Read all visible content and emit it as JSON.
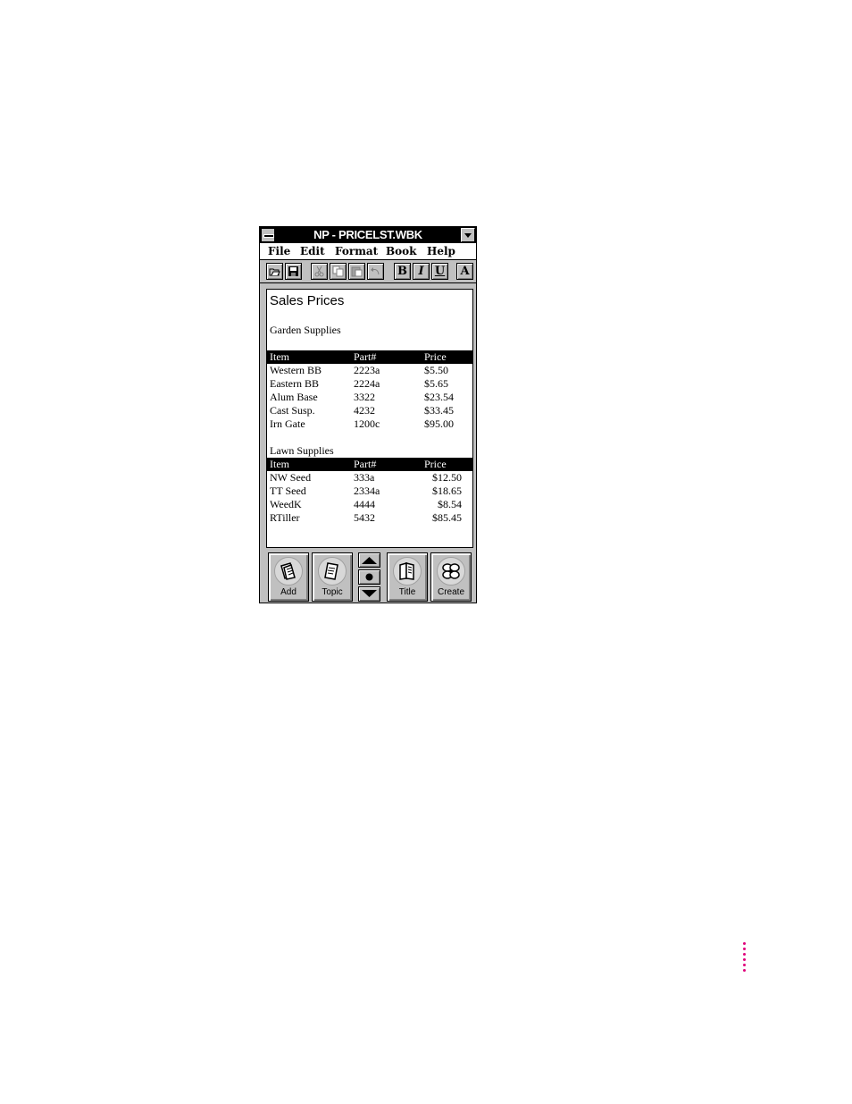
{
  "window": {
    "title": "NP - PRICELST.WBK",
    "icons": {
      "system_menu": "system-menu-icon",
      "dropdown": "dropdown-arrow-icon"
    }
  },
  "menubar": {
    "items": [
      {
        "label": "File"
      },
      {
        "label": "Edit"
      },
      {
        "label": "Format"
      },
      {
        "label": "Book"
      },
      {
        "label": "Help"
      }
    ]
  },
  "toolbar": {
    "icons": [
      "open-icon",
      "save-icon",
      "cut-icon",
      "copy-icon",
      "paste-icon",
      "undo-icon"
    ],
    "bold": "B",
    "italic": "I",
    "underline": "U",
    "font": "A"
  },
  "document": {
    "title": "Sales Prices",
    "sections": [
      {
        "name": "Garden Supplies",
        "headers": [
          "Item",
          "Part#",
          "Price"
        ],
        "rows": [
          [
            "Western BB",
            "2223a",
            "$5.50"
          ],
          [
            "Eastern BB",
            "2224a",
            "$5.65"
          ],
          [
            "Alum Base",
            "3322",
            "$23.54"
          ],
          [
            "Cast Susp.",
            "4232",
            "$33.45"
          ],
          [
            "Irn Gate",
            "1200c",
            "$95.00"
          ]
        ]
      },
      {
        "name": "Lawn Supplies",
        "headers": [
          "Item",
          "Part#",
          "Price"
        ],
        "rows": [
          [
            "NW Seed",
            "333a",
            "$12.50"
          ],
          [
            "TT Seed",
            "2334a",
            "$18.65"
          ],
          [
            "WeedK",
            "4444",
            "$8.54"
          ],
          [
            "RTiller",
            "5432",
            "$85.45"
          ]
        ]
      }
    ]
  },
  "bottombar": {
    "add": "Add",
    "topic": "Topic",
    "title": "Title",
    "create": "Create"
  },
  "colors": {
    "page_marker": "#e0007a",
    "chrome": "#c0c0c0",
    "titlebar": "#000000"
  }
}
